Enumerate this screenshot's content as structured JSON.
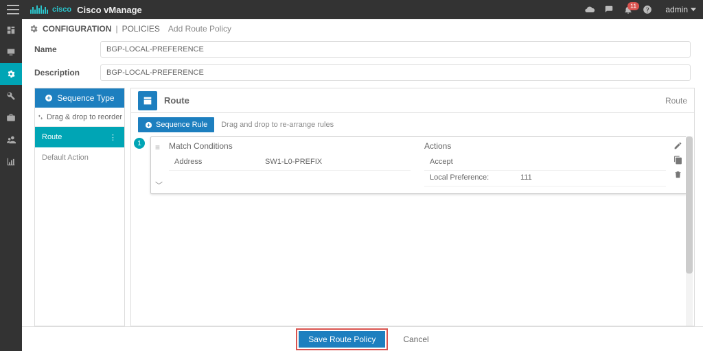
{
  "top": {
    "app": "Cisco vManage",
    "brand": "cisco",
    "notifications": "11",
    "user": "admin"
  },
  "breadcrumb": {
    "primary": "CONFIGURATION",
    "secondary": "POLICIES",
    "tail": "Add Route Policy"
  },
  "form": {
    "name_label": "Name",
    "name_value": "BGP-LOCAL-PREFERENCE",
    "desc_label": "Description",
    "desc_value": "BGP-LOCAL-PREFERENCE"
  },
  "seqpanel": {
    "seqtype_btn": "Sequence Type",
    "drag_hint": "Drag & drop to reorder",
    "item_route": "Route",
    "item_default": "Default Action"
  },
  "rulepanel": {
    "title": "Route",
    "right": "Route",
    "srule_btn": "Sequence Rule",
    "srule_hint": "Drag and drop to re-arrange rules",
    "step": "1",
    "match_h": "Match Conditions",
    "match_k": "Address",
    "match_v": "SW1-L0-PREFIX",
    "actions_h": "Actions",
    "act1": "Accept",
    "act2_k": "Local Preference:",
    "act2_v": "111"
  },
  "footer": {
    "save": "Save Route Policy",
    "cancel": "Cancel"
  }
}
